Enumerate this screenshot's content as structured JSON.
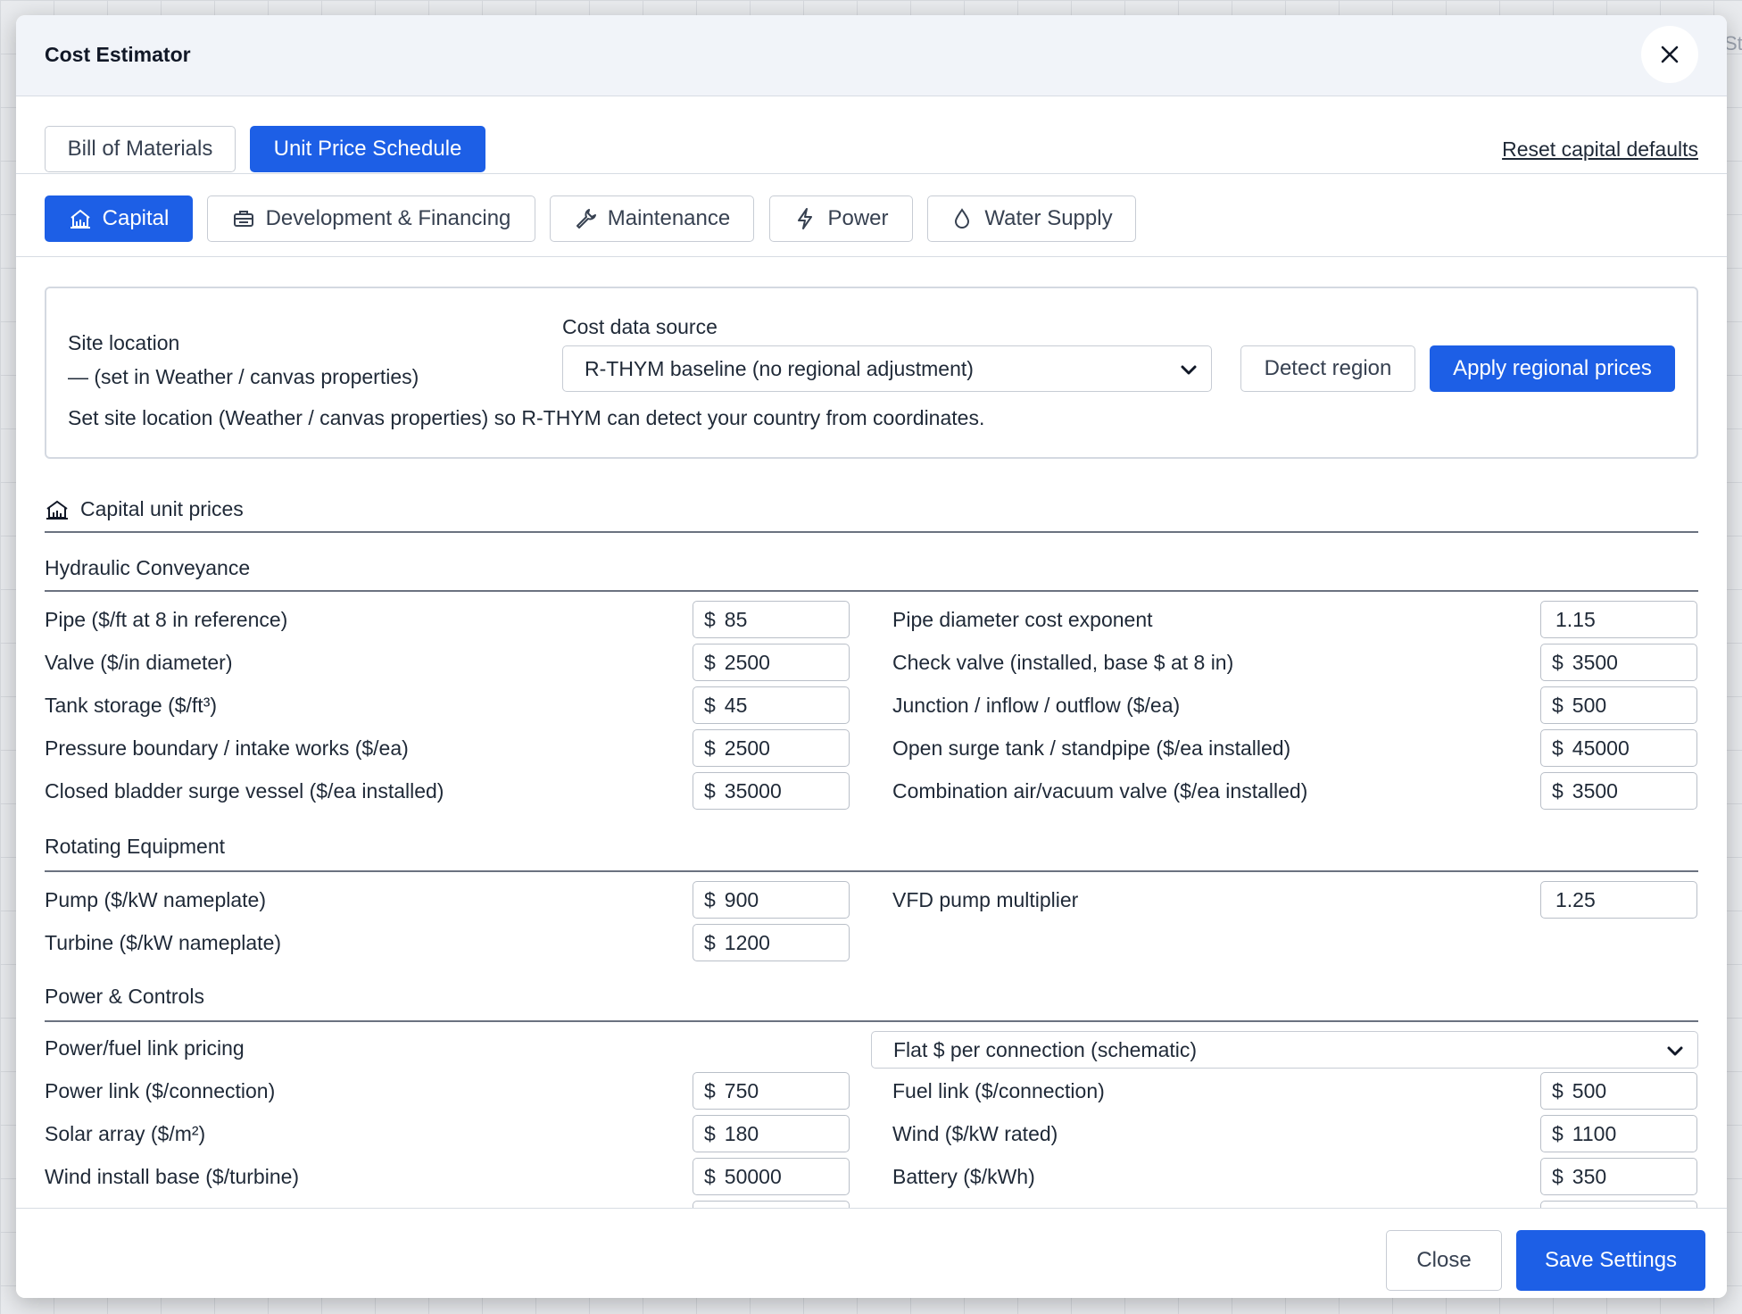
{
  "background": {
    "partial_text": "St"
  },
  "modal": {
    "title": "Cost Estimator",
    "close_icon": "close-icon"
  },
  "view_tabs": {
    "bill_of_materials": "Bill of Materials",
    "unit_price_schedule": "Unit Price Schedule",
    "active": "unit_price_schedule",
    "reset_link": "Reset capital defaults"
  },
  "category_tabs": [
    {
      "label": "Capital",
      "icon": "building-icon",
      "active": true
    },
    {
      "label": "Development & Financing",
      "icon": "briefcase-icon",
      "active": false
    },
    {
      "label": "Maintenance",
      "icon": "wrench-icon",
      "active": false
    },
    {
      "label": "Power",
      "icon": "lightning-icon",
      "active": false
    },
    {
      "label": "Water Supply",
      "icon": "droplet-icon",
      "active": false
    }
  ],
  "region": {
    "site_location_label": "Site location",
    "site_location_value": "— (set in Weather / canvas properties)",
    "cost_source_label": "Cost data source",
    "cost_source_selected": "R-THYM baseline (no regional adjustment)",
    "detect_button": "Detect region",
    "apply_button": "Apply regional prices",
    "hint": "Set site location (Weather / canvas properties) so R-THYM can detect your country from coordinates."
  },
  "capital_title": "Capital unit prices",
  "sections": {
    "hydraulic": {
      "title": "Hydraulic Conveyance",
      "left": [
        {
          "label": "Pipe ($/ft at 8 in reference)",
          "unit": "$",
          "value": "85"
        },
        {
          "label": "Valve ($/in diameter)",
          "unit": "$",
          "value": "2500"
        },
        {
          "label": "Tank storage ($/ft³)",
          "unit": "$",
          "value": "45"
        },
        {
          "label": "Pressure boundary / intake works ($/ea)",
          "unit": "$",
          "value": "2500"
        },
        {
          "label": "Closed bladder surge vessel ($/ea installed)",
          "unit": "$",
          "value": "35000"
        }
      ],
      "right": [
        {
          "label": "Pipe diameter cost exponent",
          "unit": "",
          "value": "1.15"
        },
        {
          "label": "Check valve (installed, base $ at 8 in)",
          "unit": "$",
          "value": "3500"
        },
        {
          "label": "Junction / inflow / outflow ($/ea)",
          "unit": "$",
          "value": "500"
        },
        {
          "label": "Open surge tank / standpipe ($/ea installed)",
          "unit": "$",
          "value": "45000"
        },
        {
          "label": "Combination air/vacuum valve ($/ea installed)",
          "unit": "$",
          "value": "3500"
        }
      ]
    },
    "rotating": {
      "title": "Rotating Equipment",
      "left": [
        {
          "label": "Pump ($/kW nameplate)",
          "unit": "$",
          "value": "900"
        },
        {
          "label": "Turbine ($/kW nameplate)",
          "unit": "$",
          "value": "1200"
        }
      ],
      "right": [
        {
          "label": "VFD pump multiplier",
          "unit": "",
          "value": "1.25"
        }
      ]
    },
    "power": {
      "title": "Power & Controls",
      "link_pricing_label": "Power/fuel link pricing",
      "link_pricing_selected": "Flat $ per connection (schematic)",
      "left": [
        {
          "label": "Power link ($/connection)",
          "unit": "$",
          "value": "750"
        },
        {
          "label": "Solar array ($/m²)",
          "unit": "$",
          "value": "180"
        },
        {
          "label": "Wind install base ($/turbine)",
          "unit": "$",
          "value": "50000"
        }
      ],
      "right": [
        {
          "label": "Fuel link ($/connection)",
          "unit": "$",
          "value": "500"
        },
        {
          "label": "Wind ($/kW rated)",
          "unit": "$",
          "value": "1100"
        },
        {
          "label": "Battery ($/kWh)",
          "unit": "$",
          "value": "350"
        }
      ]
    }
  },
  "footer": {
    "close_button": "Close",
    "save_button": "Save Settings"
  },
  "colors": {
    "primary": "#1d5fe6",
    "header_bg": "#f1f4f9"
  }
}
